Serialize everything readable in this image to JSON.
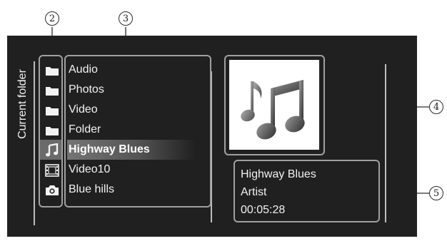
{
  "callouts": {
    "two": "2",
    "three": "3",
    "four": "4",
    "five": "5"
  },
  "sidebar": {
    "label": "Current folder"
  },
  "list": {
    "items": [
      {
        "label": "Audio",
        "icon": "folder-icon",
        "selected": false
      },
      {
        "label": "Photos",
        "icon": "folder-icon",
        "selected": false
      },
      {
        "label": "Video",
        "icon": "folder-icon",
        "selected": false
      },
      {
        "label": "Folder",
        "icon": "folder-icon",
        "selected": false
      },
      {
        "label": "Highway Blues",
        "icon": "music-note-icon",
        "selected": true
      },
      {
        "label": "Video10",
        "icon": "film-icon",
        "selected": false
      },
      {
        "label": "Blue hills",
        "icon": "camera-icon",
        "selected": false
      }
    ]
  },
  "art": {
    "icon": "music-notes-icon"
  },
  "info": {
    "title": "Highway Blues",
    "artist": "Artist",
    "duration": "00:05:28"
  },
  "colors": {
    "screen_bg": "#202020",
    "panel_border": "#a0a0a0",
    "text": "#f2f2f2",
    "selection": "#6a6a6a"
  }
}
